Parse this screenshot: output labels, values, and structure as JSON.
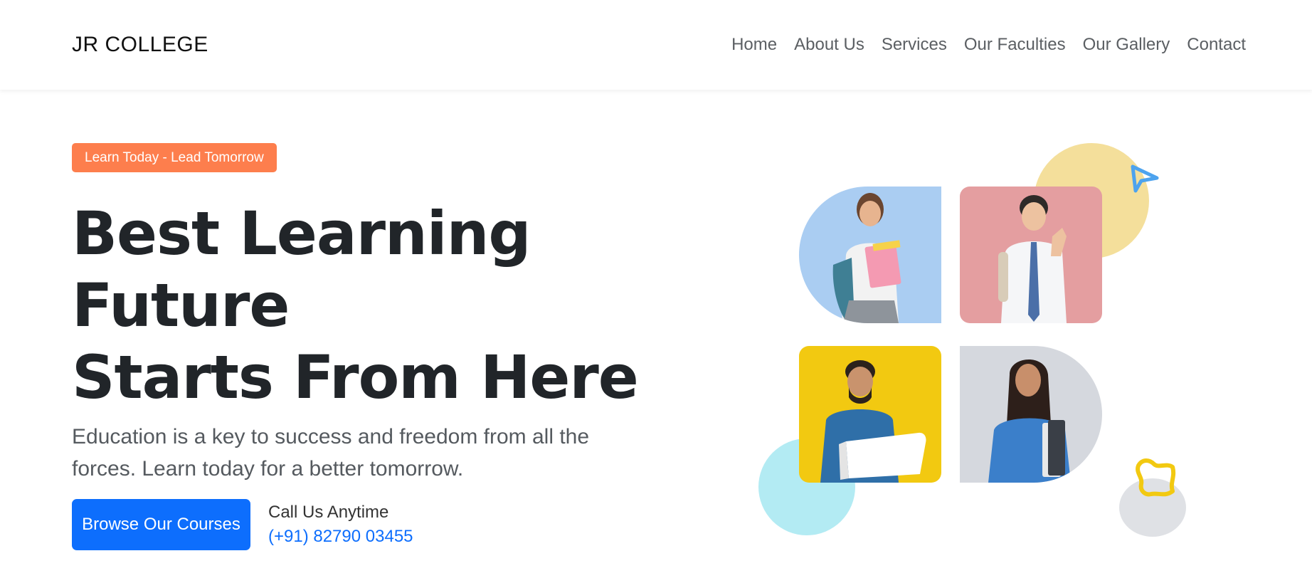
{
  "brand": "JR COLLEGE",
  "nav": {
    "items": [
      "Home",
      "About Us",
      "Services",
      "Our Faculties",
      "Our Gallery",
      "Contact"
    ]
  },
  "hero": {
    "tagline": "Learn Today - Lead Tomorrow",
    "heading_line1": "Best Learning Future",
    "heading_line2": "Starts From Here",
    "description": "Education is a key to success and freedom from all the forces. Learn today for a better tomorrow.",
    "cta_label": "Browse Our Courses",
    "call_label": "Call Us Anytime",
    "call_phone": "(+91) 82790 03455"
  },
  "colors": {
    "tagline_bg": "#fd7e4d",
    "primary": "#0d6efd",
    "tile_blue": "#aacdf2",
    "tile_pink": "#e49ea0",
    "tile_yellow": "#f2c911",
    "tile_gray": "#d5d8de",
    "blob_yellow": "#f4df9b",
    "blob_cyan": "#b3ebf3",
    "blob_gray": "#dfe1e5"
  },
  "images": {
    "tile1": "girl-student-with-books",
    "tile2": "boy-student-thumbs-up",
    "tile3": "man-with-laptop",
    "tile4": "woman-with-files"
  }
}
